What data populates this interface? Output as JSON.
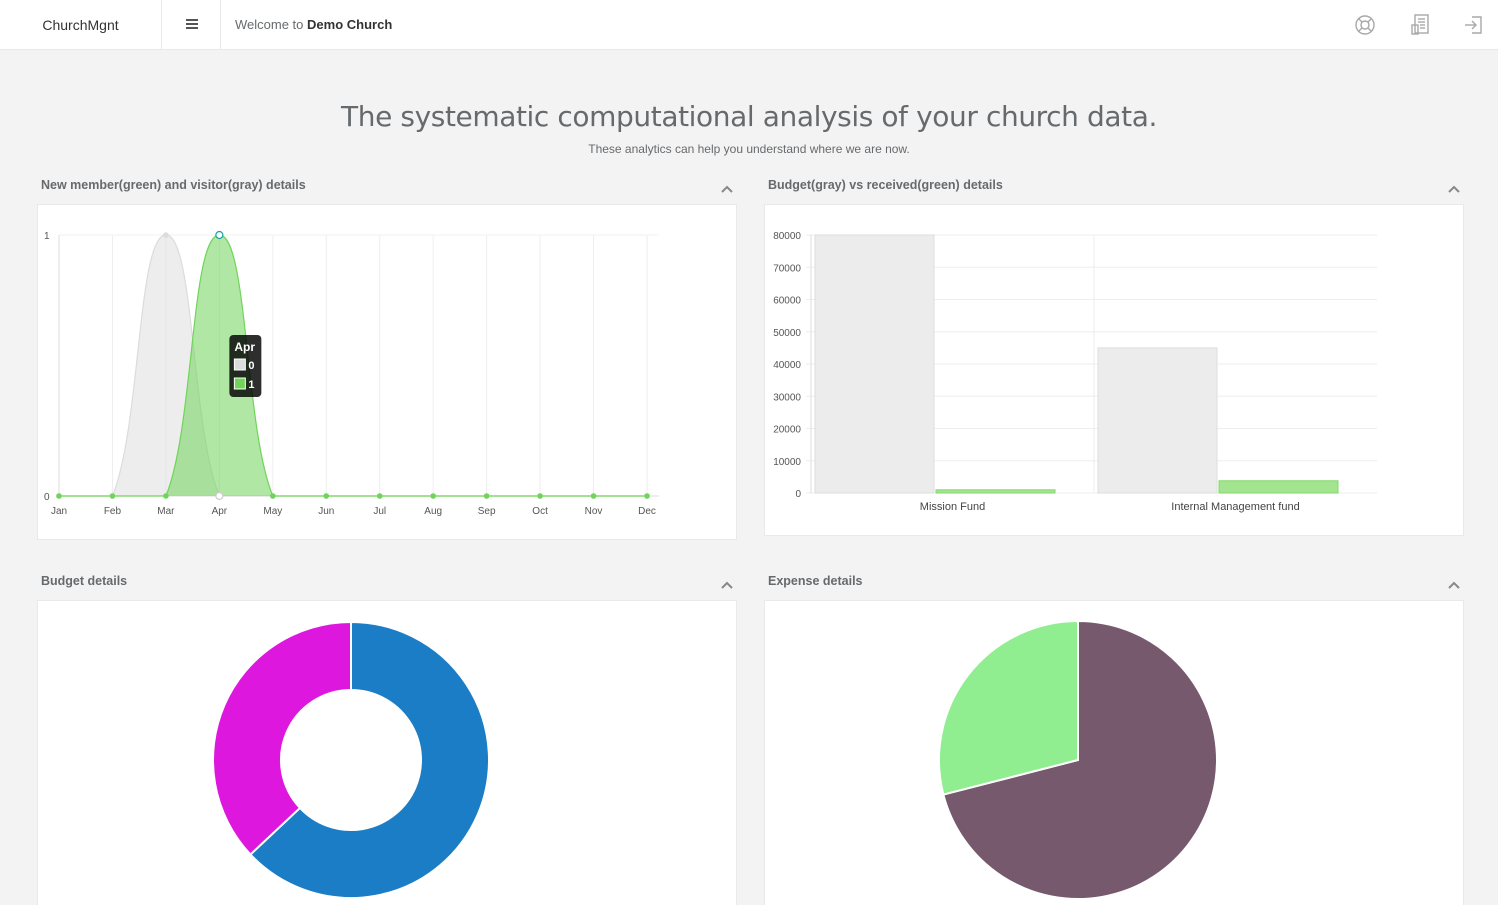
{
  "header": {
    "brand": "ChurchMgnt",
    "welcome_prefix": "Welcome to",
    "church_name": "Demo Church",
    "icons": [
      "menu-icon",
      "lifebuoy-icon",
      "report-icon",
      "sign-out-icon"
    ]
  },
  "hero": {
    "title": "The systematic computational analysis of your church data.",
    "subtitle": "These analytics can help you understand where we are now."
  },
  "panels": {
    "members": {
      "title": "New member(green) and visitor(gray) details"
    },
    "budget_received": {
      "title": "Budget(gray) vs received(green) details"
    },
    "budget": {
      "title": "Budget details"
    },
    "expense": {
      "title": "Expense details"
    }
  },
  "chart_data": [
    {
      "type": "area",
      "categories": [
        "Jan",
        "Feb",
        "Mar",
        "Apr",
        "May",
        "Jun",
        "Jul",
        "Aug",
        "Sep",
        "Oct",
        "Nov",
        "Dec"
      ],
      "ylim": [
        0,
        1
      ],
      "yticks": [
        "1",
        "0"
      ],
      "series": [
        {
          "values": [
            0,
            0,
            1,
            0,
            0,
            0,
            0,
            0,
            0,
            0,
            0,
            0
          ],
          "color": "#dcdcdc"
        },
        {
          "values": [
            0,
            0,
            0,
            1,
            0,
            0,
            0,
            0,
            0,
            0,
            0,
            0
          ],
          "color": "#70d45a"
        }
      ],
      "tooltip": {
        "title": "Apr",
        "rows": [
          "0",
          "1"
        ],
        "colors": [
          "#dcdcdc",
          "#70d45a"
        ]
      },
      "grid": true
    },
    {
      "type": "bar",
      "categories": [
        "Mission Fund",
        "Internal Management fund"
      ],
      "ylim": [
        0,
        80000
      ],
      "yticks": [
        "80000",
        "70000",
        "60000",
        "50000",
        "40000",
        "30000",
        "20000",
        "10000",
        "0"
      ],
      "series": [
        {
          "values": [
            80000,
            45000
          ],
          "color": "#ececec"
        },
        {
          "values": [
            1000,
            3800
          ],
          "color": "#a3e48f"
        }
      ],
      "grid": true
    },
    {
      "type": "pie",
      "variant": "doughnut",
      "slices": [
        {
          "value": 63,
          "color": "#1a7dc6"
        },
        {
          "value": 37,
          "color": "#de17de"
        }
      ]
    },
    {
      "type": "pie",
      "slices": [
        {
          "value": 71,
          "color": "#77596d"
        },
        {
          "value": 29,
          "color": "#90ee90"
        }
      ]
    }
  ]
}
